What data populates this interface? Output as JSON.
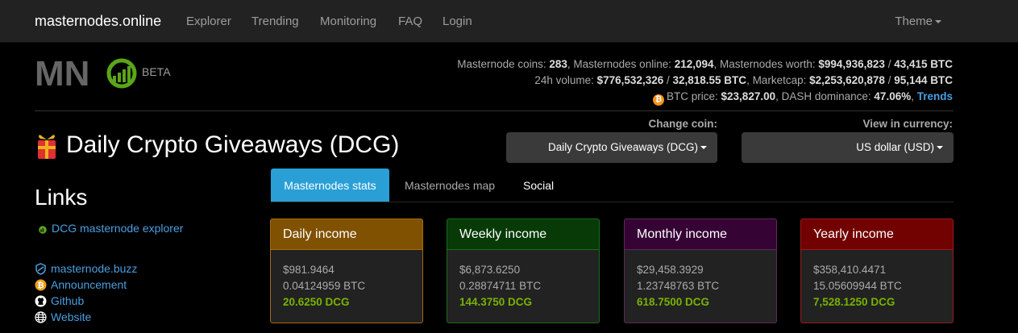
{
  "navbar": {
    "brand": "masternodes.online",
    "items": [
      "Explorer",
      "Trending",
      "Monitoring",
      "FAQ",
      "Login"
    ],
    "theme": "Theme"
  },
  "logo": {
    "text": "MN",
    "beta": "BETA"
  },
  "stats": {
    "line1": {
      "coins_label": "Masternode coins: ",
      "coins": "283",
      "online_label": ", Masternodes online: ",
      "online": "212,094",
      "worth_label": ", Masternodes worth: ",
      "worth_usd": "$994,936,823",
      "sep": " / ",
      "worth_btc": "43,415 BTC"
    },
    "line2": {
      "vol_label": "24h volume: ",
      "vol_usd": "$776,532,326",
      "sep": " / ",
      "vol_btc": "32,818.55 BTC",
      "cap_label": ", Marketcap: ",
      "cap_usd": "$2,253,620,878",
      "sep2": " / ",
      "cap_btc": "95,144 BTC"
    },
    "line3": {
      "btc_label": "BTC price: ",
      "btc_price": "$23,827.00",
      "dash_label": ", DASH dominance: ",
      "dash_dom": "47.06%",
      "comma": ", ",
      "trends": "Trends"
    }
  },
  "coin": {
    "title": "Daily Crypto Giveaways (DCG)"
  },
  "selectors": {
    "change_coin_label": "Change coin:",
    "change_coin_value": "Daily Crypto Giveaways (DCG)",
    "currency_label": "View in currency:",
    "currency_value": "US dollar (USD)"
  },
  "links": {
    "title": "Links",
    "items": [
      {
        "label": "DCG masternode explorer",
        "icon": "explorer-icon"
      },
      {
        "label": "masternode.buzz",
        "icon": "shield-icon"
      },
      {
        "label": "Announcement",
        "icon": "bitcoin-icon"
      },
      {
        "label": "Github",
        "icon": "github-icon"
      },
      {
        "label": "Website",
        "icon": "globe-icon"
      }
    ]
  },
  "tabs": [
    "Masternodes stats",
    "Masternodes map",
    "Social"
  ],
  "panels": {
    "daily": {
      "title": "Daily income",
      "usd": "$981.9464",
      "btc": "0.04124959 BTC",
      "coin": "20.6250 DCG"
    },
    "weekly": {
      "title": "Weekly income",
      "usd": "$6,873.6250",
      "btc": "0.28874711 BTC",
      "coin": "144.3750 DCG"
    },
    "monthly": {
      "title": "Monthly income",
      "usd": "$29,458.3929",
      "btc": "1.23748763 BTC",
      "coin": "618.7500 DCG"
    },
    "yearly": {
      "title": "Yearly income",
      "usd": "$358,410.4471",
      "btc": "15.05609944 BTC",
      "coin": "7,528.1250 DCG"
    }
  },
  "colors": {
    "link": "#4a9fe0",
    "active_tab": "#2a9fd6",
    "coin_amount": "#77b300",
    "daily": "#7f5100",
    "weekly": "#073a07",
    "monthly": "#350435",
    "yearly": "#720101"
  }
}
